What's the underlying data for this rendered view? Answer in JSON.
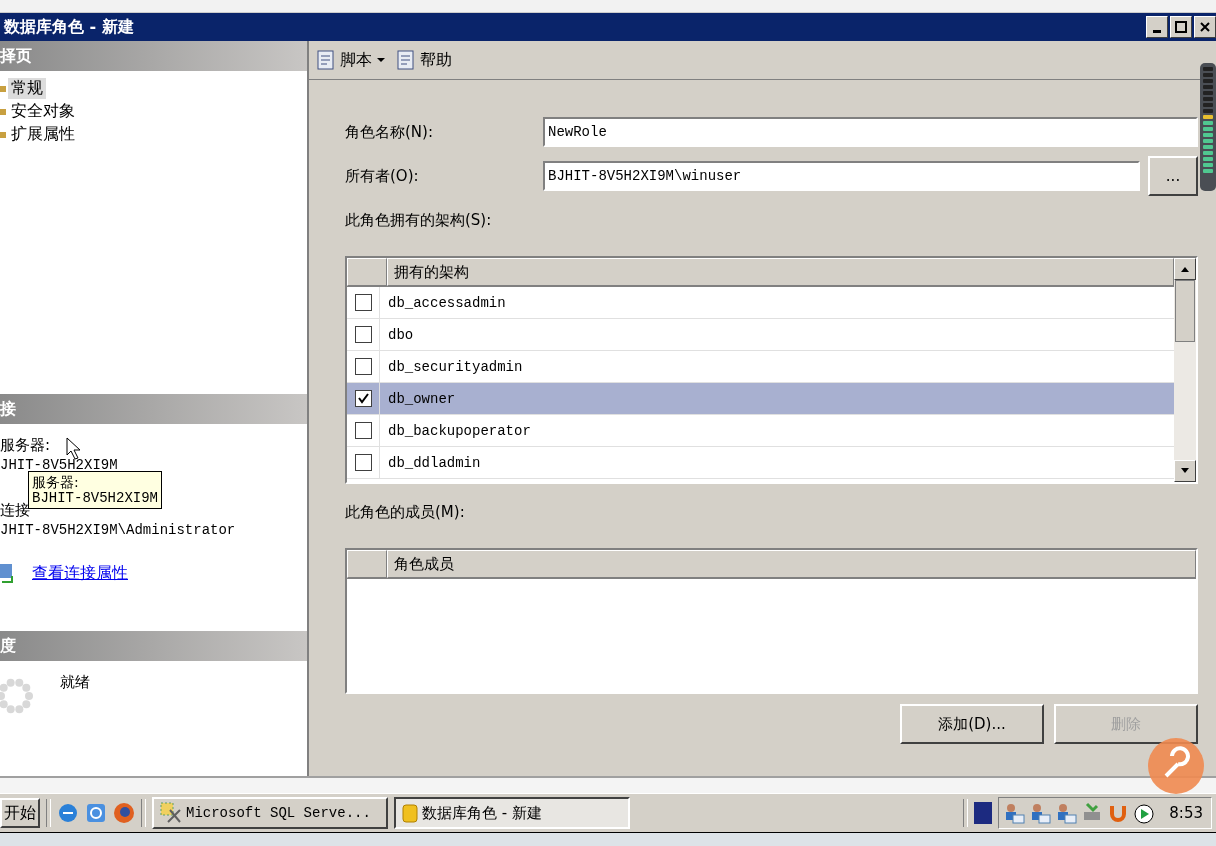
{
  "window": {
    "title": "数据库角色 - 新建"
  },
  "left": {
    "pages_header": "择页",
    "pages": [
      {
        "label": "常规",
        "selected": true
      },
      {
        "label": "安全对象",
        "selected": false
      },
      {
        "label": "扩展属性",
        "selected": false
      }
    ],
    "connection_header": "接",
    "server_label": "服务器:",
    "server_value": "JHIT-8V5H2XI9M",
    "connection_label": "连接",
    "connection_value": "JHIT-8V5H2XI9M\\Administrator",
    "link": "查看连接属性",
    "tooltip": [
      "服务器:",
      "BJHIT-8V5H2XI9M"
    ],
    "progress_header": "度",
    "status": "就绪"
  },
  "toolbar": [
    {
      "label": "脚本",
      "dropdown": true
    },
    {
      "label": "帮助",
      "dropdown": false
    }
  ],
  "form": {
    "role_name_label": "角色名称(N):",
    "role_name": "NewRole",
    "owner_label": "所有者(O):",
    "owner": "BJHIT-8V5H2XI9M\\winuser",
    "browse": "...",
    "schemas_label": "此角色拥有的架构(S):",
    "schemas_column": "拥有的架构",
    "schemas": [
      {
        "name": "db_accessadmin",
        "checked": false,
        "selected": false
      },
      {
        "name": "dbo",
        "checked": false,
        "selected": false
      },
      {
        "name": "db_securityadmin",
        "checked": false,
        "selected": false
      },
      {
        "name": "db_owner",
        "checked": true,
        "selected": true
      },
      {
        "name": "db_backupoperator",
        "checked": false,
        "selected": false
      },
      {
        "name": "db_ddladmin",
        "checked": false,
        "selected": false
      }
    ],
    "members_label": "此角色的成员(M):",
    "members_column": "角色成员"
  },
  "buttons": [
    {
      "label": "添加(D)...",
      "disabled": false
    },
    {
      "label": "删除",
      "disabled": true
    }
  ],
  "taskbar": {
    "start": "开始",
    "tasks": [
      {
        "label": "Microsoft SQL Serve...",
        "selected": false,
        "kind": "tools"
      },
      {
        "label": "数据库角色 - 新建",
        "selected": true,
        "kind": "db"
      }
    ],
    "clock": "8:53"
  }
}
